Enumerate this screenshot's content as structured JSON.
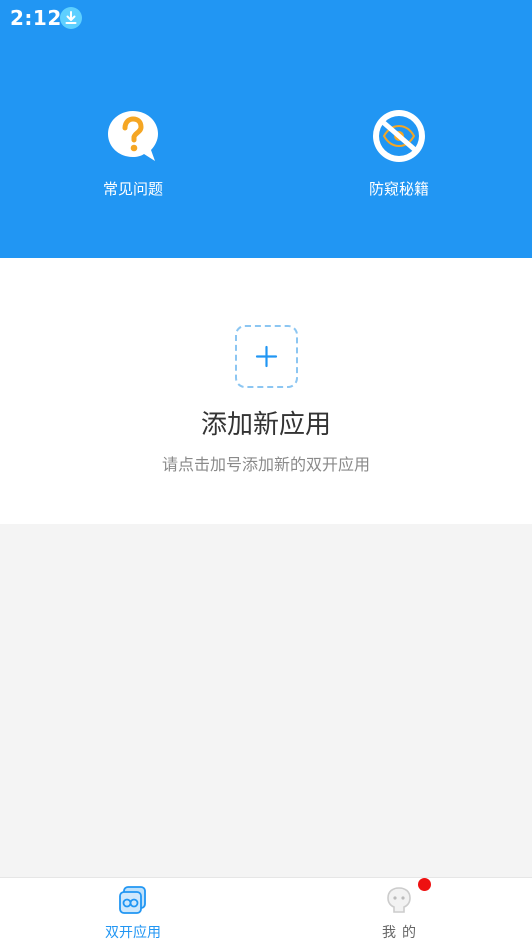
{
  "status_bar": {
    "time": "2:12",
    "icon": "download-icon"
  },
  "header": {
    "faq": {
      "label": "常见问题",
      "icon": "question-bubble-icon"
    },
    "privacy": {
      "label": "防窥秘籍",
      "icon": "eye-slash-icon"
    }
  },
  "add_app": {
    "title": "添加新应用",
    "subtitle": "请点击加号添加新的双开应用",
    "icon": "plus-icon"
  },
  "bottom_nav": {
    "items": [
      {
        "label": "双开应用",
        "icon": "dual-apps-icon",
        "active": true
      },
      {
        "label": "我的",
        "icon": "profile-icon",
        "active": false,
        "badge": true
      }
    ]
  },
  "colors": {
    "primary": "#2196f3",
    "badge": "#ee1111",
    "question_mark": "#f5a623"
  }
}
